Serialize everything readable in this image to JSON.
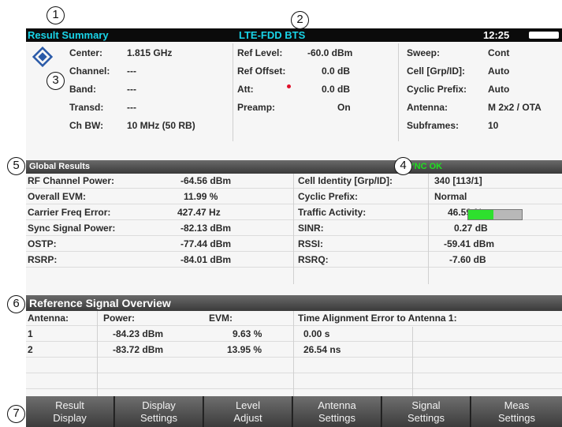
{
  "titlebar": {
    "mode": "Result Summary",
    "standard": "LTE-FDD BTS",
    "time": "12:25"
  },
  "params": {
    "center_label": "Center:",
    "center_value": "1.815 GHz",
    "channel_label": "Channel:",
    "channel_value": "---",
    "band_label": "Band:",
    "band_value": "---",
    "transd_label": "Transd:",
    "transd_value": "---",
    "chbw_label": "Ch BW:",
    "chbw_value": "10 MHz (50 RB)",
    "reflevel_label": "Ref Level:",
    "reflevel_value": "-60.0 dBm",
    "refoffset_label": "Ref Offset:",
    "refoffset_value": "0.0 dB",
    "att_label": "Att:",
    "att_value": "0.0 dB",
    "preamp_label": "Preamp:",
    "preamp_value": "On",
    "sweep_label": "Sweep:",
    "sweep_value": "Cont",
    "cell_label": "Cell [Grp/ID]:",
    "cell_value": "Auto",
    "cp_label": "Cyclic Prefix:",
    "cp_value": "Auto",
    "antenna_label": "Antenna:",
    "antenna_value": "M 2x2 / OTA",
    "subframes_label": "Subframes:",
    "subframes_value": "10"
  },
  "global": {
    "title": "Global Results",
    "sync_status": "SYNC OK",
    "rows_left": [
      {
        "label": "RF Channel Power:",
        "value": "-64.56 dBm"
      },
      {
        "label": "Overall EVM:",
        "value": "11.99 %"
      },
      {
        "label": "Carrier Freq Error:",
        "value": "427.47 Hz"
      },
      {
        "label": "Sync Signal Power:",
        "value": "-82.13 dBm"
      },
      {
        "label": "OSTP:",
        "value": "-77.44 dBm"
      },
      {
        "label": "RSRP:",
        "value": "-84.01 dBm"
      }
    ],
    "rows_right": [
      {
        "label": "Cell Identity [Grp/ID]:",
        "value": "340 [113/1]"
      },
      {
        "label": "Cyclic Prefix:",
        "value": "Normal"
      },
      {
        "label": "Traffic Activity:",
        "value": "46.59 %"
      },
      {
        "label": "SINR:",
        "value": "0.27 dB"
      },
      {
        "label": "RSSI:",
        "value": "-59.41 dBm"
      },
      {
        "label": "RSRQ:",
        "value": "-7.60 dB"
      }
    ],
    "traffic_activity_fraction": 0.4659,
    "bar_color": "#2ee02e"
  },
  "refsig": {
    "title": "Reference Signal Overview",
    "headers": {
      "antenna": "Antenna:",
      "power": "Power:",
      "evm": "EVM:",
      "tae": "Time Alignment Error to Antenna 1:"
    },
    "rows": [
      {
        "antenna": "1",
        "power": "-84.23 dBm",
        "evm": "9.63 %",
        "tae": "0.00 s"
      },
      {
        "antenna": "2",
        "power": "-83.72 dBm",
        "evm": "13.95 %",
        "tae": "26.54 ns"
      }
    ]
  },
  "softkeys": [
    {
      "line1": "Result",
      "line2": "Display"
    },
    {
      "line1": "Display",
      "line2": "Settings"
    },
    {
      "line1": "Level",
      "line2": "Adjust"
    },
    {
      "line1": "Antenna",
      "line2": "Settings"
    },
    {
      "line1": "Signal",
      "line2": "Settings"
    },
    {
      "line1": "Meas",
      "line2": "Settings"
    }
  ],
  "callouts": [
    "1",
    "2",
    "3",
    "4",
    "5",
    "6",
    "7"
  ],
  "colors": {
    "title_cyan": "#19d4e8",
    "sync_green": "#1fe01f",
    "att_marker_red": "#e0102a"
  },
  "icons": {
    "logo": "rohde-schwarz-logo-icon"
  }
}
